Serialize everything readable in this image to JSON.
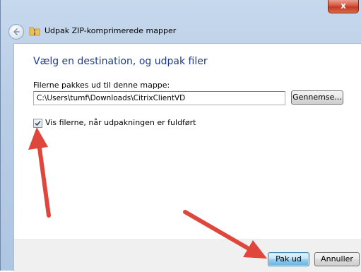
{
  "window": {
    "close_label": "x",
    "title": "Udpak ZIP-komprimerede mapper"
  },
  "content": {
    "heading": "Vælg en destination, og udpak filer",
    "field_label": "Filerne pakkes ud til denne mappe:",
    "path_value": "C:\\Users\\tumf\\Downloads\\CitrixClientVD",
    "browse_label": "Gennemse...",
    "show_files_label": "Vis filerne, når udpakningen er fuldført",
    "show_files_checked": true
  },
  "footer": {
    "extract_label": "Pak ud",
    "cancel_label": "Annuller"
  },
  "colors": {
    "heading": "#1e3a8c",
    "annotation_arrow": "#e0473c"
  },
  "icons": {
    "back": "back-arrow-icon",
    "title": "zip-folder-icon",
    "check": "checkmark-icon"
  }
}
